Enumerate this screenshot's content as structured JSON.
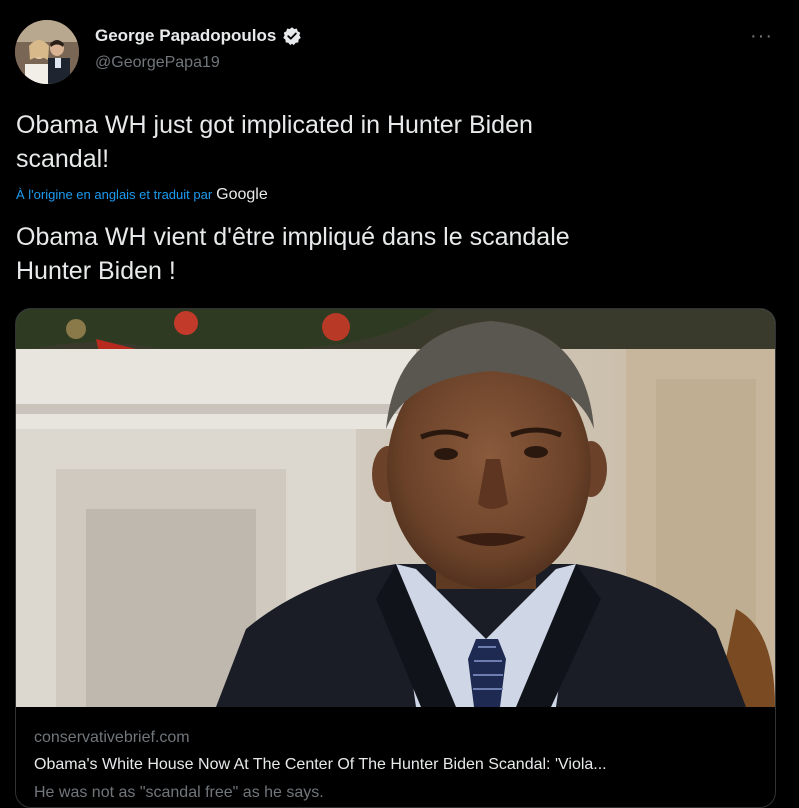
{
  "author": {
    "display_name": "George Papadopoulos",
    "handle": "@GeorgePapa19",
    "verified_icon": "verified-badge-icon",
    "avatar": "avatar-photo"
  },
  "menu": {
    "more_label": "···"
  },
  "tweet": {
    "text_line1": "Obama WH just got implicated in Hunter Biden",
    "text_line2": "scandal!",
    "translation_note": "À l'origine en anglais et traduit par",
    "translation_provider": "Google",
    "translated_line1": "Obama WH vient d'être impliqué dans le scandale",
    "translated_line2": "Hunter Biden !"
  },
  "card": {
    "image": "photo-of-man-in-suit",
    "domain": "conservativebrief.com",
    "title": "Obama's White House Now At The Center Of The Hunter Biden Scandal: 'Viola...",
    "description": "He was not as \"scandal free\" as he says."
  },
  "colors": {
    "background": "#000000",
    "text_primary": "#e7e9ea",
    "text_secondary": "#71767b",
    "link_blue": "#1d9bf0",
    "border": "#2f3336"
  }
}
